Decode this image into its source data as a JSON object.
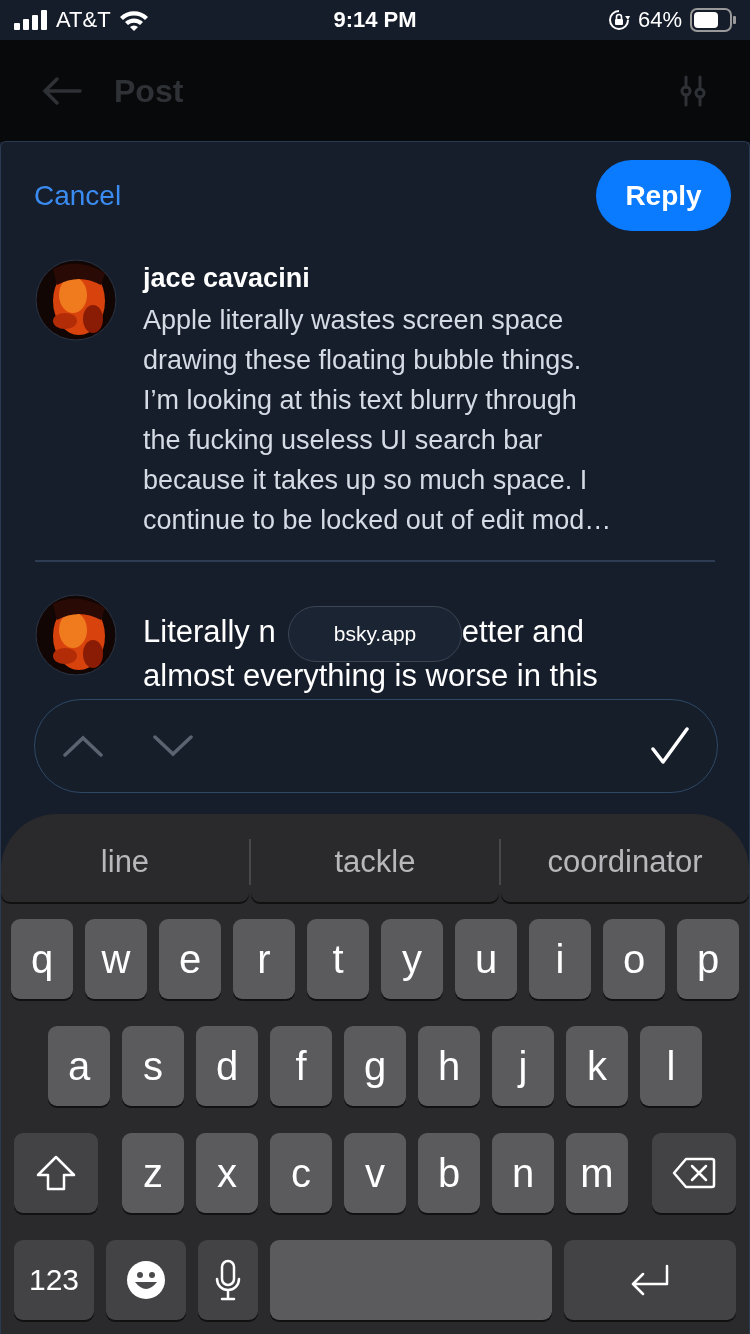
{
  "status_bar": {
    "carrier": "AT&T",
    "time": "9:14 PM",
    "battery": "64%"
  },
  "header": {
    "title": "Post"
  },
  "composer": {
    "cancel": "Cancel",
    "reply": "Reply",
    "quoted_post": {
      "author": "jace cavacini",
      "text": "Apple literally wastes screen space\ndrawing these floating bubble things.\nI’m looking at this text blurry through\nthe fucking useless UI search bar\nbecause it takes up so much space. I\ncontinue to be locked out of edit mod…"
    },
    "draft_lines": [
      [
        "Literally n",
        "etter and"
      ],
      [
        "almost everything is worse in this"
      ]
    ],
    "url_pill": "bsky.app"
  },
  "keyboard": {
    "suggestions": [
      "line",
      "tackle",
      "coordinator"
    ],
    "rows": [
      [
        {
          "kind": "letter",
          "label": "q"
        },
        {
          "kind": "letter",
          "label": "w"
        },
        {
          "kind": "letter",
          "label": "e"
        },
        {
          "kind": "letter",
          "label": "r"
        },
        {
          "kind": "letter",
          "label": "t"
        },
        {
          "kind": "letter",
          "label": "y"
        },
        {
          "kind": "letter",
          "label": "u"
        },
        {
          "kind": "letter",
          "label": "i"
        },
        {
          "kind": "letter",
          "label": "o"
        },
        {
          "kind": "letter",
          "label": "p"
        }
      ],
      [
        {
          "kind": "letter",
          "label": "a"
        },
        {
          "kind": "letter",
          "label": "s"
        },
        {
          "kind": "letter",
          "label": "d"
        },
        {
          "kind": "letter",
          "label": "f"
        },
        {
          "kind": "letter",
          "label": "g"
        },
        {
          "kind": "letter",
          "label": "h"
        },
        {
          "kind": "letter",
          "label": "j"
        },
        {
          "kind": "letter",
          "label": "k"
        },
        {
          "kind": "letter",
          "label": "l"
        }
      ],
      [
        {
          "kind": "shift"
        },
        {
          "kind": "letter",
          "label": "z"
        },
        {
          "kind": "letter",
          "label": "x"
        },
        {
          "kind": "letter",
          "label": "c"
        },
        {
          "kind": "letter",
          "label": "v"
        },
        {
          "kind": "letter",
          "label": "b"
        },
        {
          "kind": "letter",
          "label": "n"
        },
        {
          "kind": "letter",
          "label": "m"
        },
        {
          "kind": "backspace"
        }
      ],
      [
        {
          "kind": "numbers",
          "label": "123"
        },
        {
          "kind": "emoji"
        },
        {
          "kind": "mic"
        },
        {
          "kind": "space"
        },
        {
          "kind": "return"
        }
      ]
    ]
  }
}
